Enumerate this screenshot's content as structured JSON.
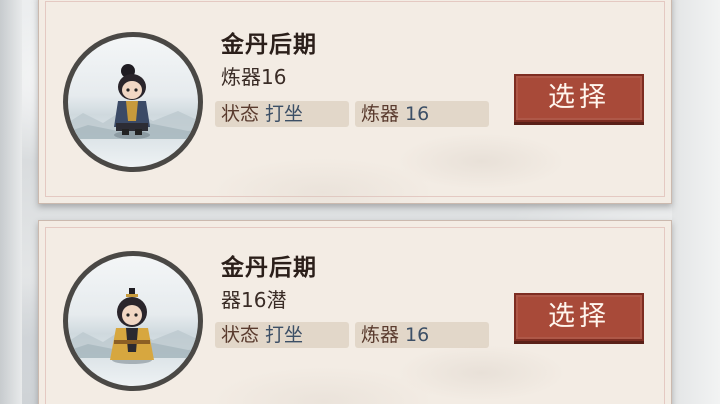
{
  "cards": [
    {
      "realm": "金丹后期",
      "subtitle": "炼器16",
      "state_label": "状态",
      "state_value": "打坐",
      "skill_label": "炼器",
      "skill_value": "16",
      "button_label": "选择",
      "avatar_icon": "cultivator-female-portrait"
    },
    {
      "realm": "金丹后期",
      "subtitle": "器16潜",
      "state_label": "状态",
      "state_value": "打坐",
      "skill_label": "炼器",
      "skill_value": "16",
      "button_label": "选择",
      "avatar_icon": "cultivator-male-portrait"
    }
  ],
  "colors": {
    "button": "#a84a39",
    "card": "#f3ece4",
    "tag": "#e2d7c9"
  }
}
